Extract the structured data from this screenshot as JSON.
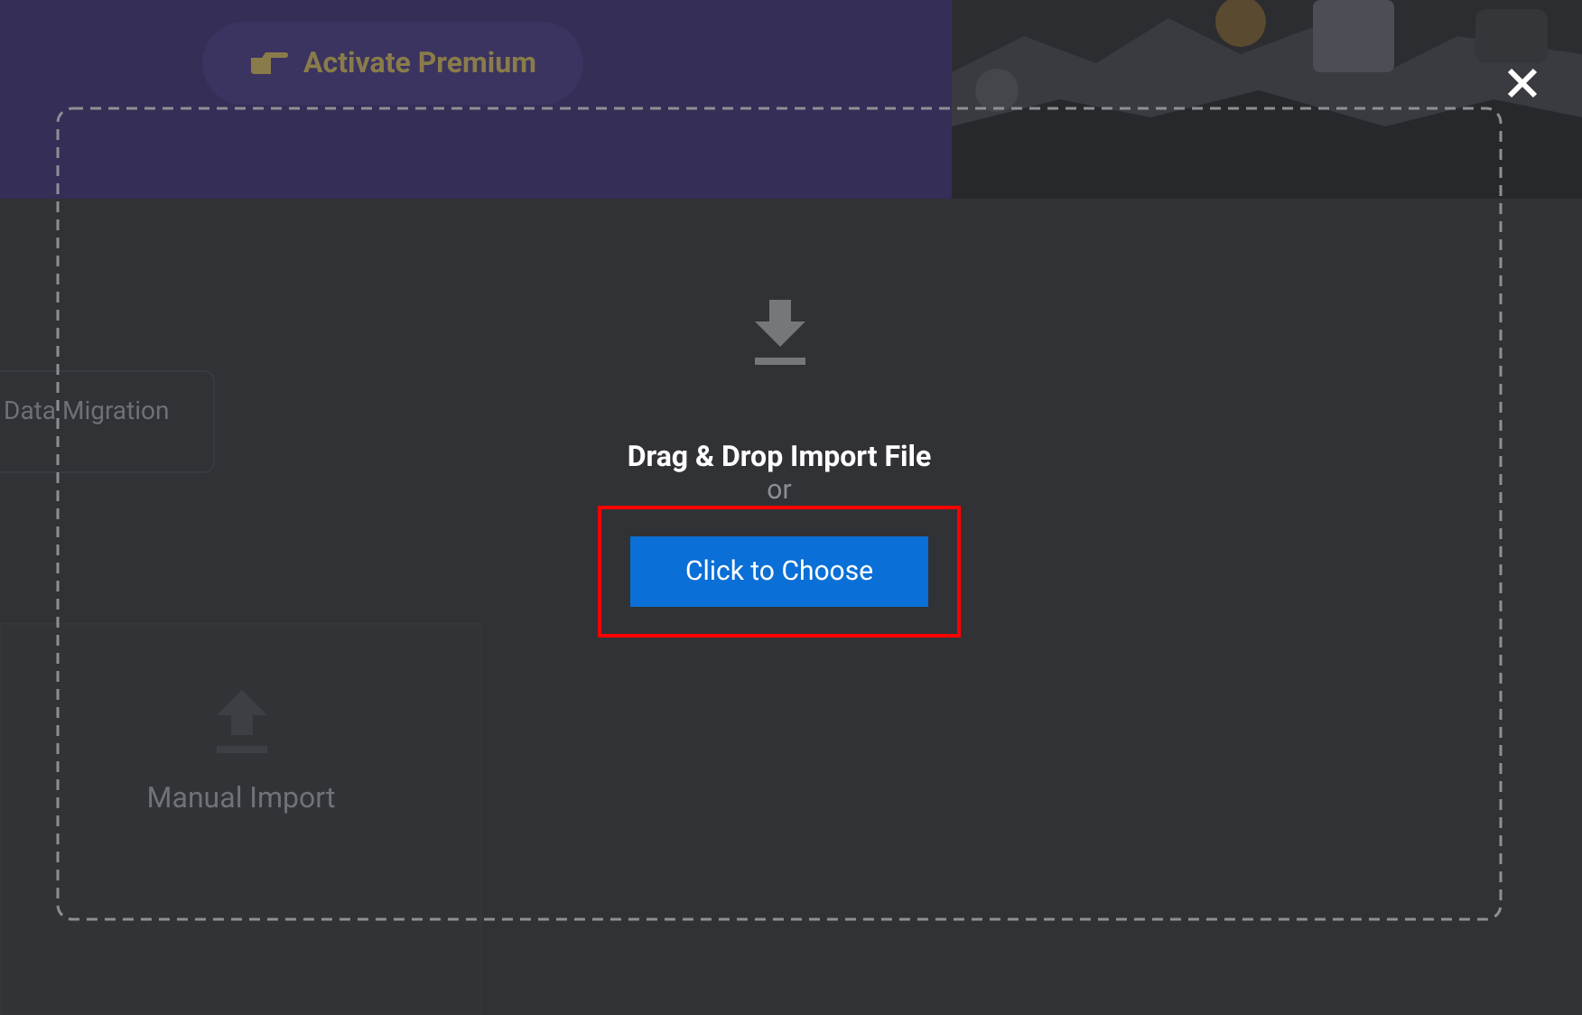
{
  "background_page": {
    "premium_button": {
      "label": "Activate Premium"
    },
    "migration_button": {
      "label": "Data Migration"
    },
    "manual_import_card": {
      "label": "Manual Import"
    }
  },
  "import_dialog": {
    "title": "Drag & Drop Import File",
    "separator": "or",
    "choose_button": {
      "label": "Click to Choose",
      "highlighted": true
    }
  }
}
